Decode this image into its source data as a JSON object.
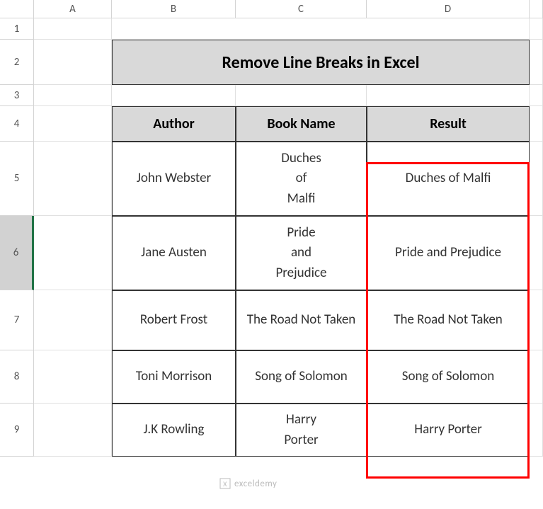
{
  "columns": [
    "A",
    "B",
    "C",
    "D"
  ],
  "rows": [
    "1",
    "2",
    "3",
    "4",
    "5",
    "6",
    "7",
    "8",
    "9"
  ],
  "selected_row": "6",
  "title": "Remove Line Breaks in Excel",
  "headers": {
    "author": "Author",
    "book_name": "Book Name",
    "result": "Result"
  },
  "data": [
    {
      "author": "John Webster",
      "book_name": "Duches\nof\nMalfi",
      "result": "Duches of Malfi"
    },
    {
      "author": "Jane Austen",
      "book_name": "Pride\nand\nPrejudice",
      "result": "Pride and  Prejudice"
    },
    {
      "author": "Robert Frost",
      "book_name": "The Road Not Taken",
      "result": "The Road Not Taken"
    },
    {
      "author": "Toni Morrison",
      "book_name": "Song of Solomon",
      "result": "Song of Solomon"
    },
    {
      "author": "J.K Rowling",
      "book_name": "Harry\nPorter",
      "result": "Harry Porter"
    }
  ],
  "watermark": "exceldemy"
}
